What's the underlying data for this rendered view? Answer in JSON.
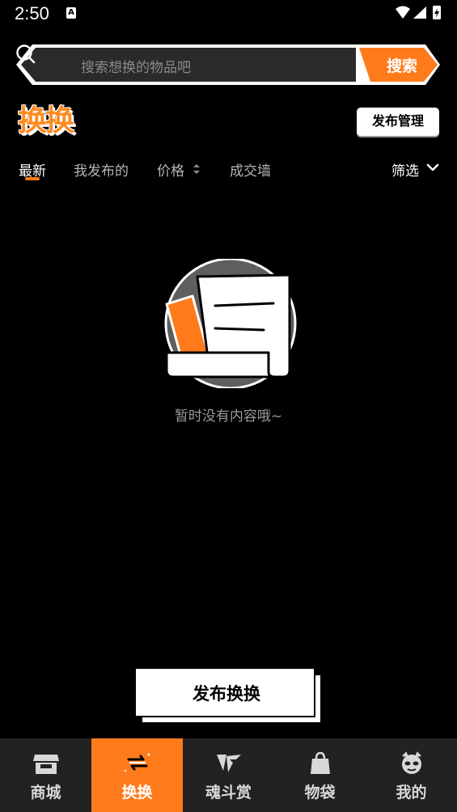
{
  "status_bar": {
    "time": "2:50",
    "notification_badge": "A"
  },
  "search": {
    "placeholder": "搜索想换的物品吧",
    "button_label": "搜索"
  },
  "header": {
    "logo_text": "换换",
    "manage_button": "发布管理"
  },
  "tabs": [
    {
      "label": "最新",
      "active": true
    },
    {
      "label": "我发布的",
      "active": false
    },
    {
      "label": "价格",
      "active": false
    },
    {
      "label": "成交墙",
      "active": false
    }
  ],
  "filter": {
    "label": "筛选"
  },
  "empty_state": {
    "message": "暂时没有内容哦~"
  },
  "publish_button": {
    "label": "发布换换"
  },
  "bottom_nav": [
    {
      "label": "商城",
      "icon": "shop-icon",
      "active": false
    },
    {
      "label": "换换",
      "icon": "exchange-icon",
      "active": true
    },
    {
      "label": "魂斗赏",
      "icon": "prize-icon",
      "active": false
    },
    {
      "label": "物袋",
      "icon": "bag-icon",
      "active": false
    },
    {
      "label": "我的",
      "icon": "profile-icon",
      "active": false
    }
  ],
  "colors": {
    "accent": "#ff7a1a",
    "background": "#000000",
    "nav_background": "#222222"
  }
}
